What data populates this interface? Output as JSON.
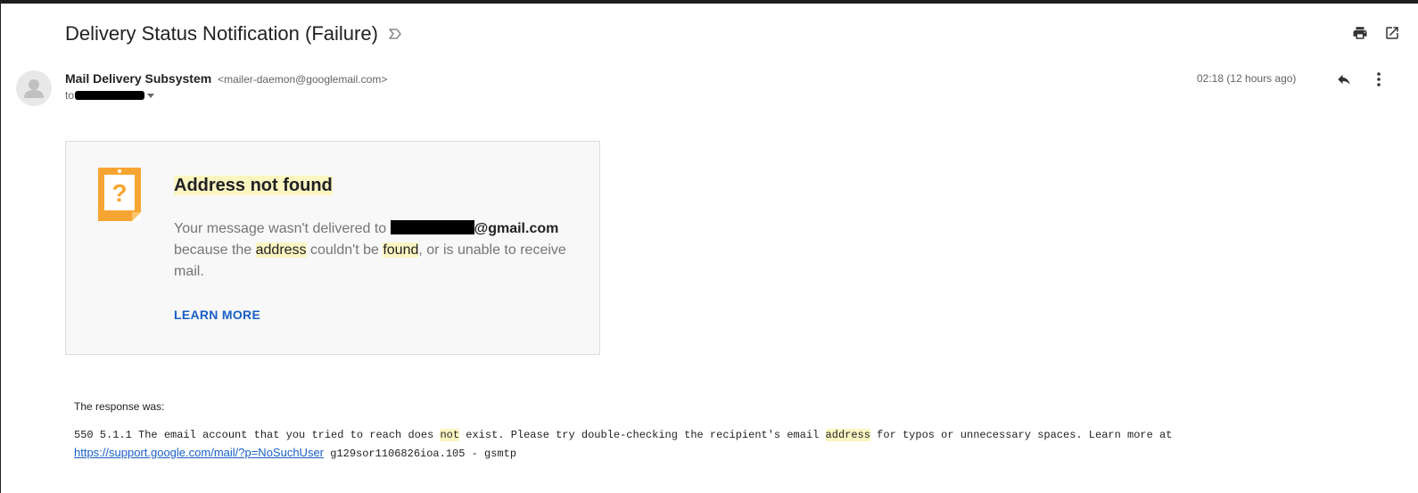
{
  "subject": "Delivery Status Notification (Failure)",
  "sender": {
    "name": "Mail Delivery Subsystem",
    "email": "<mailer-daemon@googlemail.com>"
  },
  "recipient": {
    "prefix": "to"
  },
  "timestamp": "02:18 (12 hours ago)",
  "card": {
    "heading": "Address not found",
    "text": {
      "part1": "Your message wasn't delivered to ",
      "email_domain": "@gmail.com",
      "part2": "because the ",
      "word_address": "address",
      "part3": " couldn't be ",
      "word_found": "found",
      "part4": ", or is unable to receive mail."
    },
    "learn_more": "LEARN MORE"
  },
  "response": {
    "label": "The response was:",
    "code_part1": "550 5.1.1 The email account that you tried to reach does ",
    "word_not": "not",
    "code_part2": " exist. Please try double-checking the recipient's email ",
    "word_address": "address",
    "code_part3": " for typos or unnecessary spaces. Learn more at ",
    "link": "https://support.google.com/mail/?p=NoSuchUser",
    "code_part4": " g129sor1106826ioa.105 - gsmtp"
  },
  "icons": {
    "label": "label-icon",
    "print": "print-icon",
    "open_new": "open-in-new-icon",
    "reply": "reply-icon",
    "more": "more-vert-icon",
    "avatar": "avatar-icon",
    "warning": "question-note-icon"
  }
}
